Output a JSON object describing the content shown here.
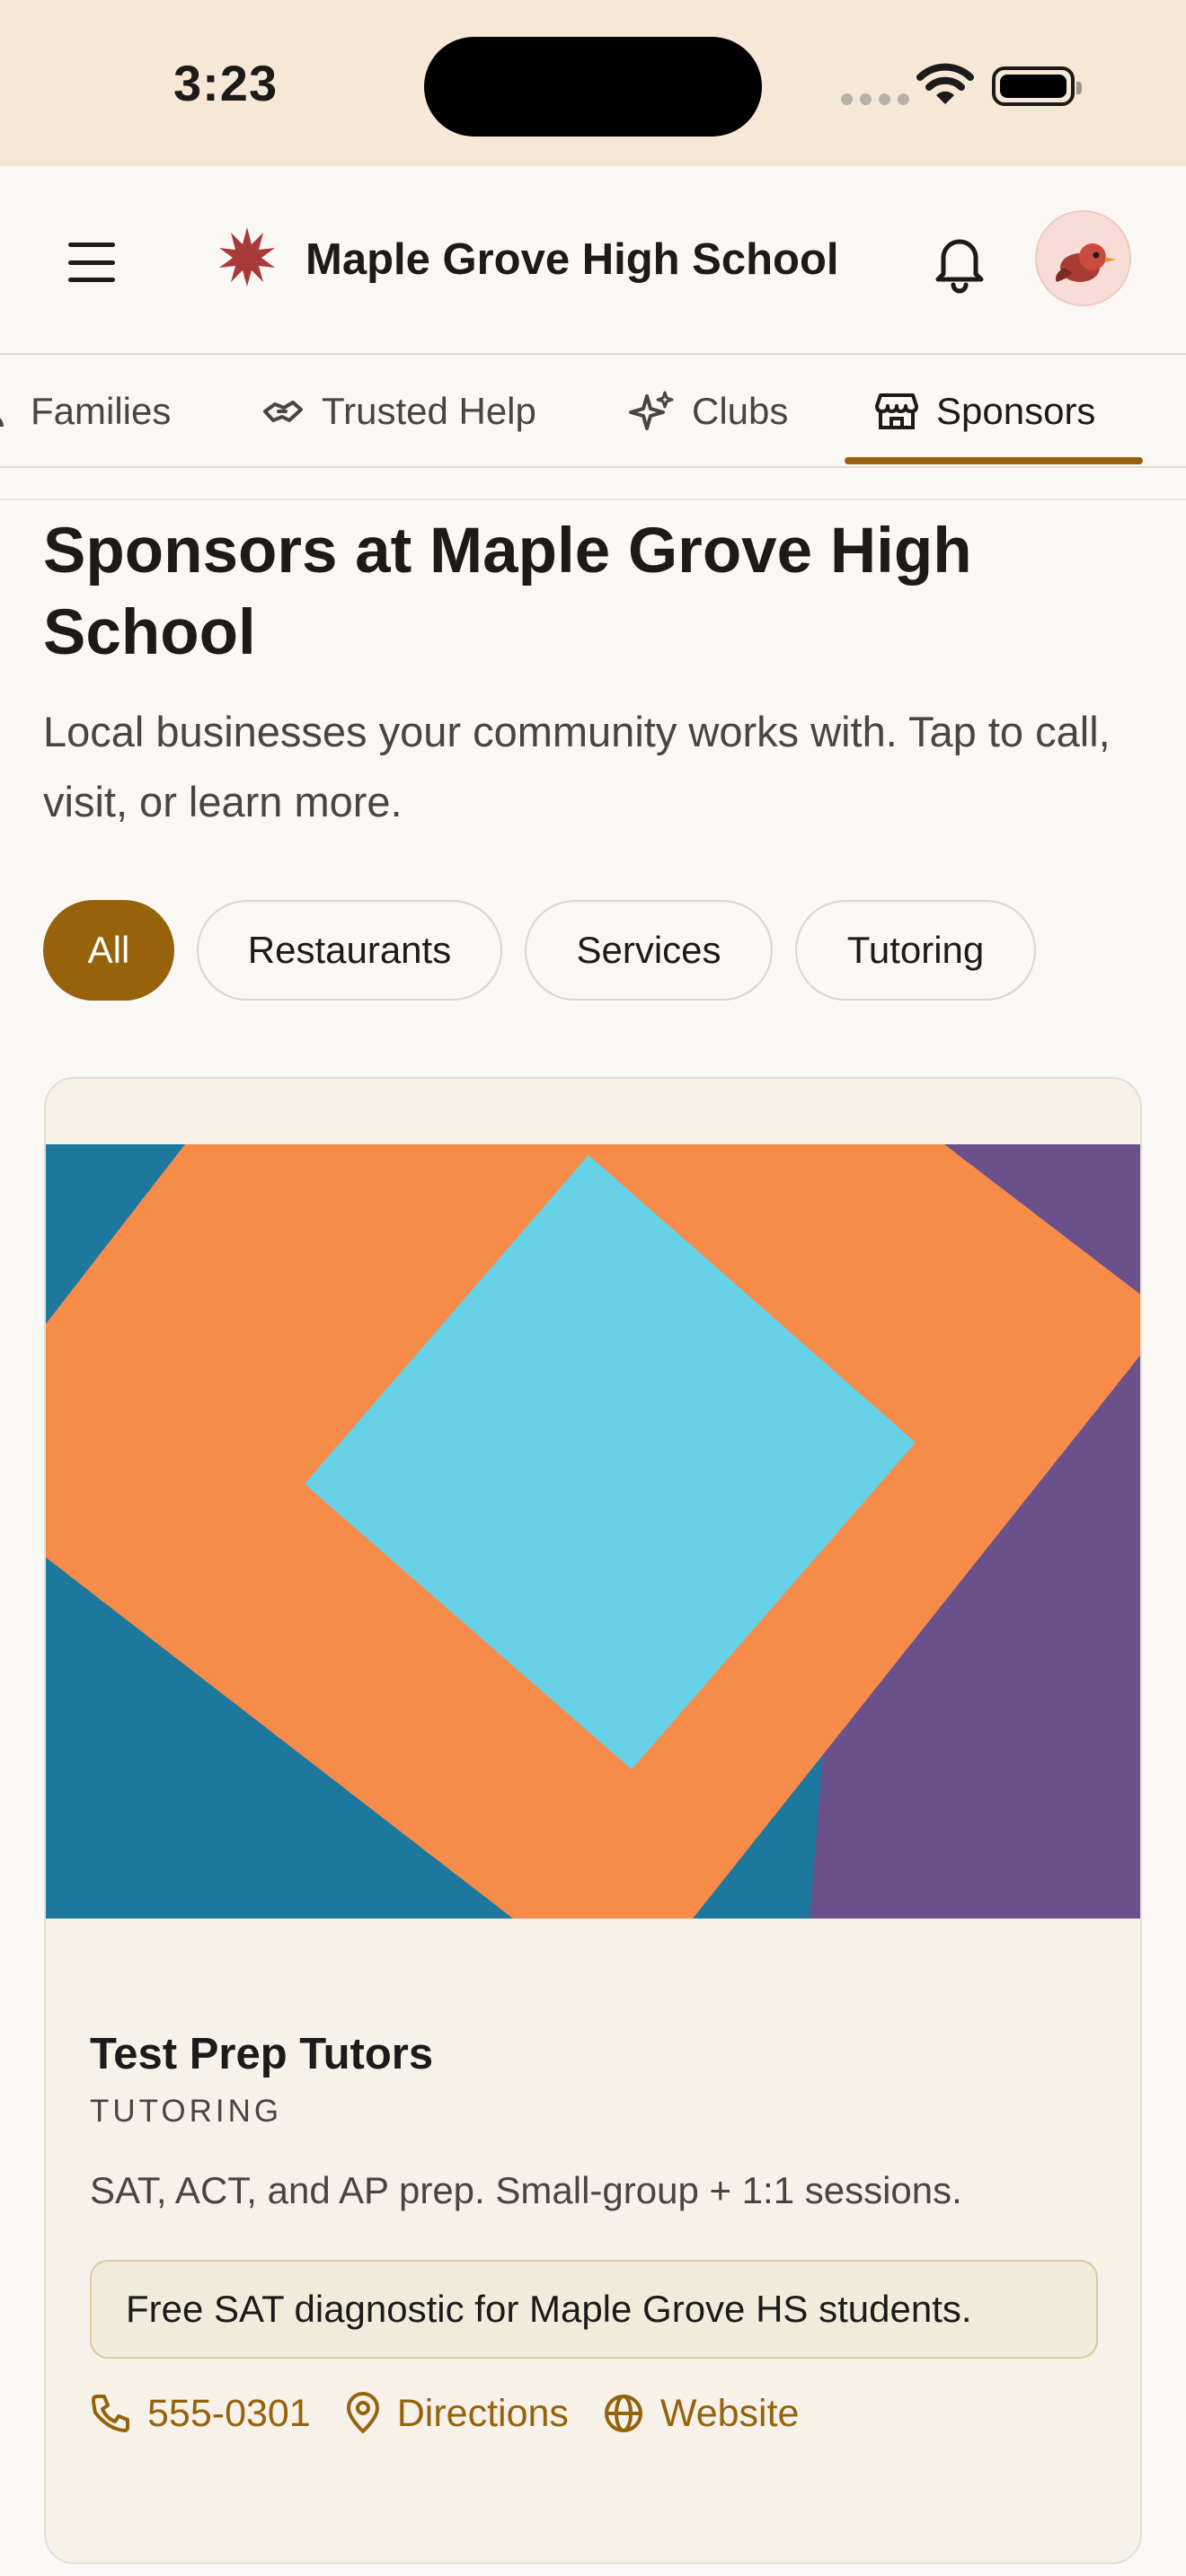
{
  "status_bar": {
    "time": "3:23"
  },
  "app_bar": {
    "title": "Maple Grove High School"
  },
  "tabs": [
    {
      "label": "Families",
      "icon": "people-icon"
    },
    {
      "label": "Trusted Help",
      "icon": "handshake-icon"
    },
    {
      "label": "Clubs",
      "icon": "sparkles-icon"
    },
    {
      "label": "Sponsors",
      "icon": "storefront-icon",
      "active": true
    }
  ],
  "page": {
    "title": "Sponsors at Maple Grove High School",
    "subtitle": "Local businesses your community works with. Tap to call, visit, or learn more."
  },
  "filters": [
    {
      "label": "All",
      "selected": true
    },
    {
      "label": "Restaurants"
    },
    {
      "label": "Services"
    },
    {
      "label": "Tutoring"
    }
  ],
  "sponsor_card": {
    "name": "Test Prep Tutors",
    "category": "TUTORING",
    "description": "SAT, ACT, and AP prep. Small-group + 1:1 sessions.",
    "offer": "Free SAT diagnostic for Maple Grove HS students.",
    "actions": {
      "phone": "555-0301",
      "directions": "Directions",
      "website": "Website"
    }
  },
  "colors": {
    "accent": "#96620b",
    "status_bar_bg": "#f6e8d7",
    "card_bg": "#f6f1e9",
    "image_teal": "#1e789e",
    "image_orange": "#f78c4a",
    "image_cyan": "#66d1e6",
    "image_purple": "#6a518b"
  }
}
